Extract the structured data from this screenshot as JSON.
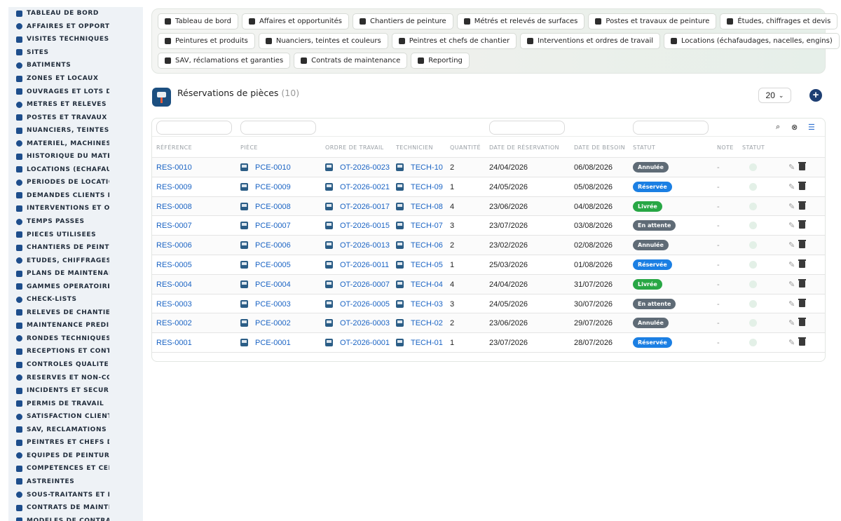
{
  "sidebar": {
    "items": [
      {
        "label": "TABLEAU DE BORD",
        "icon": "dashboard-icon"
      },
      {
        "label": "AFFAIRES ET OPPORTUN",
        "icon": "target-icon"
      },
      {
        "label": "VISITES TECHNIQUES ET",
        "icon": "clipboard-icon"
      },
      {
        "label": "SITES",
        "icon": "map-pin-icon"
      },
      {
        "label": "BÂTIMENTS",
        "icon": "building-icon"
      },
      {
        "label": "ZONES ET LOCAUX",
        "icon": "layers-icon"
      },
      {
        "label": "OUVRAGES ET LOTS DE T",
        "icon": "sitemap-icon"
      },
      {
        "label": "MÉTRÉS ET RELEVÉS DE",
        "icon": "ruler-icon"
      },
      {
        "label": "POSTES ET TRAVAUX DE",
        "icon": "paint-roller-icon"
      },
      {
        "label": "NUANCIERS, TEINTES ET",
        "icon": "palette-icon"
      },
      {
        "label": "MATÉRIEL, MACHINES ET",
        "icon": "cogs-icon"
      },
      {
        "label": "HISTORIQUE DU MATÉRIE",
        "icon": "history-icon"
      },
      {
        "label": "LOCATIONS (ÉCHAFAUDA",
        "icon": "truck-icon"
      },
      {
        "label": "PÉRIODES DE LOCATION",
        "icon": "calendar-icon"
      },
      {
        "label": "DEMANDES CLIENTS ET I",
        "icon": "question-icon"
      },
      {
        "label": "INTERVENTIONS ET ORDI",
        "icon": "clipboard-list-icon"
      },
      {
        "label": "TEMPS PASSÉS",
        "icon": "clock-icon"
      },
      {
        "label": "PIÈCES UTILISÉES",
        "icon": "box-icon"
      },
      {
        "label": "CHANTIERS DE PEINTURI",
        "icon": "brush-icon"
      },
      {
        "label": "ÉTUDES, CHIFFRAGES ET",
        "icon": "calculator-icon"
      },
      {
        "label": "PLANS DE MAINTENANCE",
        "icon": "calendar-check-icon"
      },
      {
        "label": "GAMMES OPÉRATOIRES",
        "icon": "list-icon"
      },
      {
        "label": "CHECK-LISTS",
        "icon": "checklist-icon"
      },
      {
        "label": "RELEVÉS DE CHANTIER",
        "icon": "file-icon"
      },
      {
        "label": "MAINTENANCE PRÉDICTI",
        "icon": "chart-line-icon"
      },
      {
        "label": "RONDES TECHNIQUES",
        "icon": "route-icon"
      },
      {
        "label": "RÉCEPTIONS ET CONTRÔ",
        "icon": "search-icon"
      },
      {
        "label": "CONTRÔLES QUALITÉ ET",
        "icon": "check-square-icon"
      },
      {
        "label": "RÉSERVES ET NON-CONF",
        "icon": "alert-circle-icon"
      },
      {
        "label": "INCIDENTS ET SÉCURITÉ",
        "icon": "warning-icon"
      },
      {
        "label": "PERMIS DE TRAVAIL",
        "icon": "document-icon"
      },
      {
        "label": "SATISFACTION CLIENT",
        "icon": "smile-icon"
      },
      {
        "label": "SAV, RÉCLAMATIONS ET (",
        "icon": "headset-icon"
      },
      {
        "label": "PEINTRES ET CHEFS DE (",
        "icon": "hard-hat-icon"
      },
      {
        "label": "ÉQUIPES DE PEINTURE",
        "icon": "users-icon"
      },
      {
        "label": "COMPÉTENCES ET CERTI",
        "icon": "certificate-icon"
      },
      {
        "label": "ASTREINTES",
        "icon": "phone-icon"
      },
      {
        "label": "SOUS-TRAITANTS ET FOU",
        "icon": "handshake-icon"
      },
      {
        "label": "CONTRATS DE MAINTENA",
        "icon": "contract-icon"
      },
      {
        "label": "MODÈLES DE CONTRATS",
        "icon": "template-icon"
      }
    ]
  },
  "nav": {
    "rows": [
      [
        {
          "label": "Tableau de bord",
          "icon": "dashboard-icon"
        },
        {
          "label": "Affaires et opportunités",
          "icon": "target-icon"
        },
        {
          "label": "Chantiers de peinture",
          "icon": "brush-icon"
        },
        {
          "label": "Métrés et relevés de surfaces",
          "icon": "ruler-icon"
        },
        {
          "label": "Postes et travaux de peinture",
          "icon": "paint-roller-icon"
        },
        {
          "label": "Études, chiffrages et devis",
          "icon": "calculator-icon"
        }
      ],
      [
        {
          "label": "Peintures et produits",
          "icon": "paint-bucket-icon"
        },
        {
          "label": "Nuanciers, teintes et couleurs",
          "icon": "palette-icon"
        },
        {
          "label": "Peintres et chefs de chantier",
          "icon": "hard-hat-icon"
        },
        {
          "label": "Interventions et ordres de travail",
          "icon": "clipboard-list-icon"
        },
        {
          "label": "Locations (échafaudages, nacelles, engins)",
          "icon": "truck-icon"
        }
      ],
      [
        {
          "label": "SAV, réclamations et garanties",
          "icon": "headset-icon"
        },
        {
          "label": "Contrats de maintenance",
          "icon": "contract-icon"
        },
        {
          "label": "Reporting",
          "icon": "chart-pie-icon"
        }
      ]
    ]
  },
  "page": {
    "title": "Réservations de pièces",
    "count": "(10)",
    "per_page": "20",
    "add_icon": "plus-circle-icon"
  },
  "table": {
    "headers": [
      "RÉFÉRENCE",
      "PIÈCE",
      "ORDRE DE TRAVAIL",
      "TECHNICIEN",
      "QUANTITÉ",
      "DATE DE RÉSERVATION",
      "DATE DE BESOIN",
      "STATUT",
      "NOTE",
      "STATUT"
    ],
    "status_colors": {
      "Annulée": "#5f6b76",
      "Réservée": "#1b7fe3",
      "Livrée": "#28a745",
      "En attente": "#5f6b76"
    },
    "rows": [
      {
        "ref": "RES-0010",
        "piece": "PCE-0010",
        "ot": "OT-2026-0023",
        "tech": "TECH-10",
        "qty": "2",
        "date_res": "24/04/2026",
        "date_need": "06/08/2026",
        "status": "Annulée",
        "note": "-"
      },
      {
        "ref": "RES-0009",
        "piece": "PCE-0009",
        "ot": "OT-2026-0021",
        "tech": "TECH-09",
        "qty": "1",
        "date_res": "24/05/2026",
        "date_need": "05/08/2026",
        "status": "Réservée",
        "note": "-"
      },
      {
        "ref": "RES-0008",
        "piece": "PCE-0008",
        "ot": "OT-2026-0017",
        "tech": "TECH-08",
        "qty": "4",
        "date_res": "23/06/2026",
        "date_need": "04/08/2026",
        "status": "Livrée",
        "note": "-"
      },
      {
        "ref": "RES-0007",
        "piece": "PCE-0007",
        "ot": "OT-2026-0015",
        "tech": "TECH-07",
        "qty": "3",
        "date_res": "23/07/2026",
        "date_need": "03/08/2026",
        "status": "En attente",
        "note": "-"
      },
      {
        "ref": "RES-0006",
        "piece": "PCE-0006",
        "ot": "OT-2026-0013",
        "tech": "TECH-06",
        "qty": "2",
        "date_res": "23/02/2026",
        "date_need": "02/08/2026",
        "status": "Annulée",
        "note": "-"
      },
      {
        "ref": "RES-0005",
        "piece": "PCE-0005",
        "ot": "OT-2026-0011",
        "tech": "TECH-05",
        "qty": "1",
        "date_res": "25/03/2026",
        "date_need": "01/08/2026",
        "status": "Réservée",
        "note": "-"
      },
      {
        "ref": "RES-0004",
        "piece": "PCE-0004",
        "ot": "OT-2026-0007",
        "tech": "TECH-04",
        "qty": "4",
        "date_res": "24/04/2026",
        "date_need": "31/07/2026",
        "status": "Livrée",
        "note": "-"
      },
      {
        "ref": "RES-0003",
        "piece": "PCE-0003",
        "ot": "OT-2026-0005",
        "tech": "TECH-03",
        "qty": "3",
        "date_res": "24/05/2026",
        "date_need": "30/07/2026",
        "status": "En attente",
        "note": "-"
      },
      {
        "ref": "RES-0002",
        "piece": "PCE-0002",
        "ot": "OT-2026-0003",
        "tech": "TECH-02",
        "qty": "2",
        "date_res": "23/06/2026",
        "date_need": "29/07/2026",
        "status": "Annulée",
        "note": "-"
      },
      {
        "ref": "RES-0001",
        "piece": "PCE-0001",
        "ot": "OT-2026-0001",
        "tech": "TECH-01",
        "qty": "1",
        "date_res": "23/07/2026",
        "date_need": "28/07/2026",
        "status": "Réservée",
        "note": "-"
      }
    ]
  }
}
